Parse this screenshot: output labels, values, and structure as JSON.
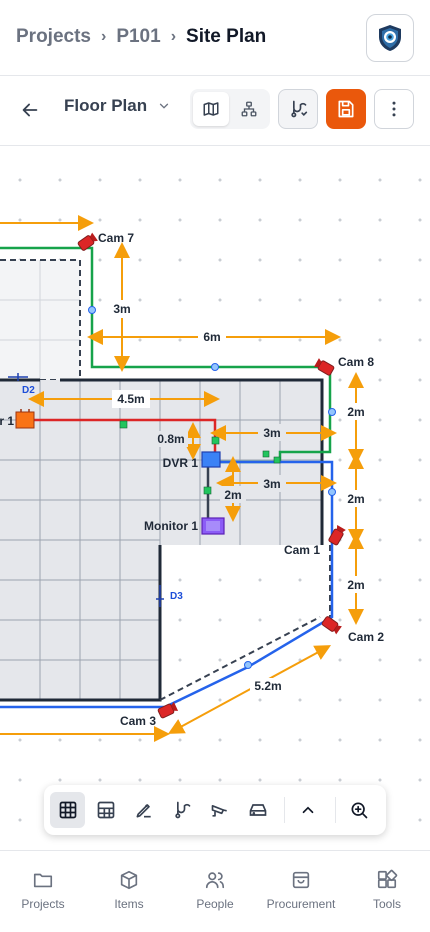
{
  "breadcrumb": {
    "items": [
      "Projects",
      "P101",
      "Site Plan"
    ]
  },
  "toolbar": {
    "view_label": "Floor Plan"
  },
  "plan": {
    "cameras": [
      "Cam 7",
      "Cam 8",
      "Cam 1",
      "Cam 2",
      "Cam 3"
    ],
    "dvr": "DVR 1",
    "monitor": "Monitor 1",
    "doors": [
      "D2",
      "D3"
    ],
    "partial_label": "r 1",
    "dimensions": [
      "3m",
      "6m",
      "4.5m",
      "0.8m",
      "3m",
      "3m",
      "2m",
      "2m",
      "2m",
      "2m",
      "5.2m"
    ]
  },
  "bottom_nav": {
    "items": [
      {
        "label": "Projects"
      },
      {
        "label": "Items"
      },
      {
        "label": "People"
      },
      {
        "label": "Procurement"
      },
      {
        "label": "Tools"
      }
    ]
  },
  "colors": {
    "accent": "#ea580c",
    "dimension": "#f59e0b",
    "wall": "#1f2937",
    "green_cable": "#16a34a",
    "blue_cable": "#2563eb",
    "red_cable": "#dc2626",
    "camera": "#dc2626",
    "monitor": "#8b5cf6"
  }
}
